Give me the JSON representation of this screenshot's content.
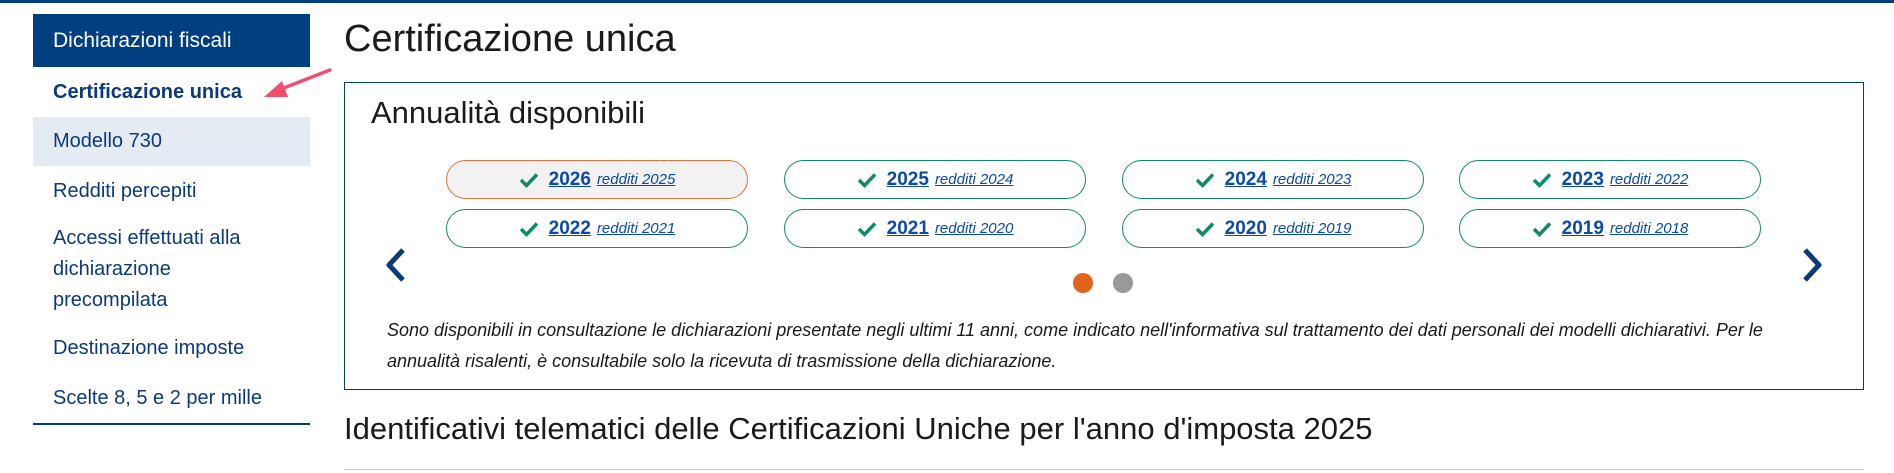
{
  "sidebar": {
    "header": "Dichiarazioni fiscali",
    "items": [
      {
        "label": "Certificazione unica"
      },
      {
        "label": "Modello 730"
      },
      {
        "label": "Redditi percepiti"
      },
      {
        "label": "Accessi effettuati alla dichiarazione precompilata"
      },
      {
        "label": "Destinazione imposte"
      },
      {
        "label": "Scelte 8, 5 e 2 per mille"
      }
    ]
  },
  "main": {
    "title": "Certificazione unica",
    "panel": {
      "title": "Annualità disponibili",
      "chips": [
        {
          "year": "2026",
          "sub": "redditi 2025",
          "selected": true
        },
        {
          "year": "2025",
          "sub": "redditi 2024"
        },
        {
          "year": "2024",
          "sub": "redditi 2023"
        },
        {
          "year": "2023",
          "sub": "redditi 2022"
        },
        {
          "year": "2022",
          "sub": "redditi 2021"
        },
        {
          "year": "2021",
          "sub": "redditi 2020"
        },
        {
          "year": "2020",
          "sub": "redditi 2019"
        },
        {
          "year": "2019",
          "sub": "redditi 2018"
        }
      ],
      "pagination": {
        "current": 1,
        "total": 2
      },
      "note": "Sono disponibili in consultazione le dichiarazioni presentate negli ultimi 11 anni, come indicato nell'informativa sul trattamento dei dati personali dei modelli dichiarativi. Per le annualità risalenti, è consultabile solo la ricevuta di trasmissione della dichiarazione."
    },
    "section_title": "Identificativi telematici delle Certificazioni Uniche per l'anno d'imposta 2025"
  },
  "colors": {
    "brand": "#003f7f",
    "chip_border": "#0f8a6a",
    "selected_border": "#e0703a",
    "dot_active": "#e0631f",
    "annotation_arrow": "#f0506e"
  },
  "icons": {
    "check": "check-icon",
    "prev": "chevron-left-icon",
    "next": "chevron-right-icon",
    "annotation": "arrow-annotation-icon"
  }
}
